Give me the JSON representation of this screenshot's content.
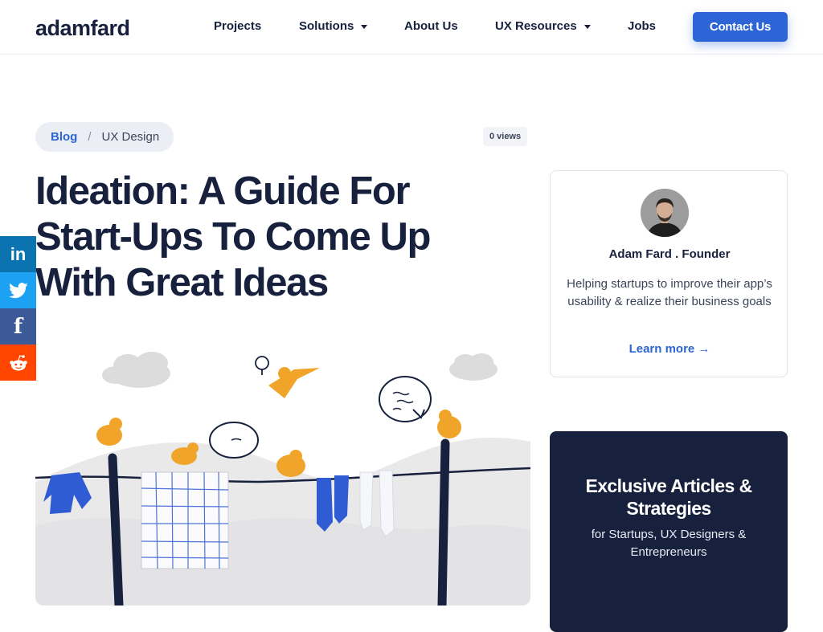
{
  "header": {
    "logo": "adamfard",
    "nav": [
      {
        "label": "Projects",
        "dropdown": false
      },
      {
        "label": "Solutions",
        "dropdown": true
      },
      {
        "label": "About Us",
        "dropdown": false
      },
      {
        "label": "UX Resources",
        "dropdown": true
      },
      {
        "label": "Jobs",
        "dropdown": false
      }
    ],
    "cta": "Contact Us"
  },
  "breadcrumb": {
    "root": "Blog",
    "separator": "/",
    "current": "UX Design"
  },
  "views": "0 views",
  "article": {
    "title_lines": [
      "Ideation: A Guide For",
      "Start-Ups To Come Up",
      "With Great Ideas"
    ]
  },
  "social": [
    {
      "icon": "linkedin-icon",
      "glyph": "in"
    },
    {
      "icon": "twitter-icon",
      "glyph": ""
    },
    {
      "icon": "facebook-icon",
      "glyph": "f"
    },
    {
      "icon": "reddit-icon",
      "glyph": ""
    }
  ],
  "author": {
    "name": "Adam Fard . Founder",
    "description": "Helping startups to improve their app’s usability & realize their business goals",
    "link": "Learn more →"
  },
  "promo": {
    "title": "Exclusive Articles & Strategies",
    "subtitle": "for Startups, UX Designers & Entrepreneurs"
  },
  "colors": {
    "accent": "#2d65d6",
    "navy": "#17213d",
    "bird": "#f0a42a",
    "cloth_blue": "#2f5bd3"
  }
}
